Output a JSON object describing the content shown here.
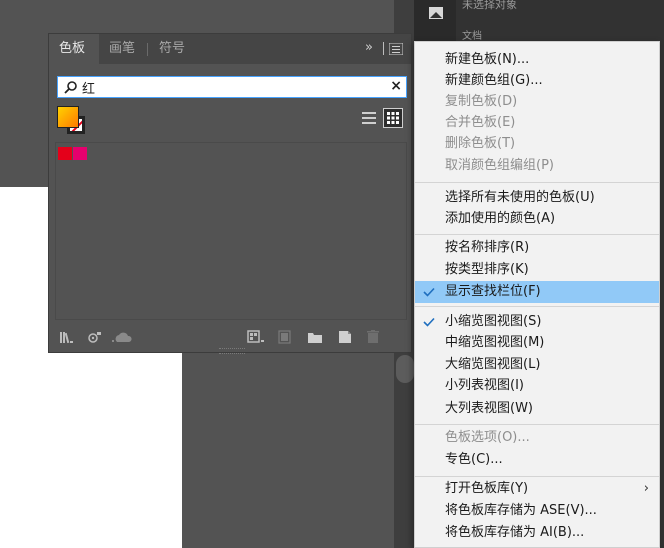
{
  "background_panel": {
    "top_text": "未选择对象",
    "second_text": "文档"
  },
  "swatches_panel": {
    "tabs": [
      "色板",
      "画笔",
      "符号"
    ],
    "active_tab": "色板",
    "menu_controls": "»",
    "search": {
      "value": "红",
      "clear_icon": "×"
    },
    "swatches": [
      {
        "color": "#e4001a"
      },
      {
        "color": "#e6006e"
      }
    ],
    "bottom_icons": [
      "swatch-library-icon",
      "show-kinds-icon",
      "cloud-icon",
      "swatch-options-icon",
      "color-group-icon",
      "new-folder-icon",
      "new-swatch-icon",
      "delete-icon"
    ]
  },
  "menu": {
    "items": [
      {
        "label": "新建色板(N)...",
        "disabled": false
      },
      {
        "label": "新建颜色组(G)...",
        "disabled": false
      },
      {
        "label": "复制色板(D)",
        "disabled": true
      },
      {
        "label": "合并色板(E)",
        "disabled": true
      },
      {
        "label": "删除色板(T)",
        "disabled": true
      },
      {
        "label": "取消颜色组编组(P)",
        "disabled": true
      },
      {
        "label": "选择所有未使用的色板(U)",
        "disabled": false
      },
      {
        "label": "添加使用的颜色(A)",
        "disabled": false
      },
      {
        "label": "按名称排序(R)",
        "disabled": false
      },
      {
        "label": "按类型排序(K)",
        "disabled": false
      },
      {
        "label": "显示查找栏位(F)",
        "disabled": false,
        "checked": true,
        "highlighted": true
      },
      {
        "label": "小缩览图视图(S)",
        "disabled": false,
        "checked": true
      },
      {
        "label": "中缩览图视图(M)",
        "disabled": false
      },
      {
        "label": "大缩览图视图(L)",
        "disabled": false
      },
      {
        "label": "小列表视图(I)",
        "disabled": false
      },
      {
        "label": "大列表视图(W)",
        "disabled": false
      },
      {
        "label": "色板选项(O)...",
        "disabled": true
      },
      {
        "label": "专色(C)...",
        "disabled": false
      },
      {
        "label": "打开色板库(Y)",
        "disabled": false,
        "submenu": true
      },
      {
        "label": "将色板库存储为 ASE(V)...",
        "disabled": false
      },
      {
        "label": "将色板库存储为 AI(B)...",
        "disabled": false
      }
    ],
    "submenu_arrow": "›",
    "highlight_color": "#91c9f7"
  }
}
